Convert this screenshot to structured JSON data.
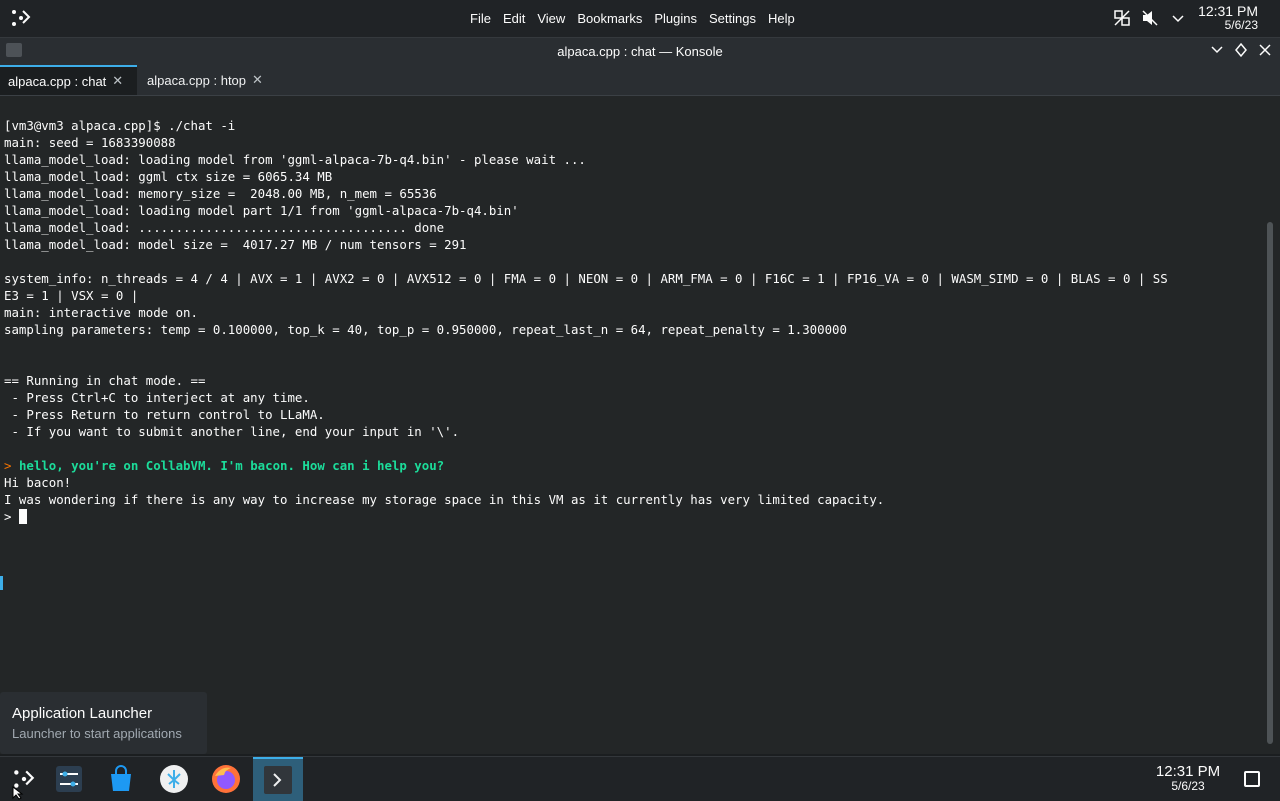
{
  "top_panel": {
    "menu": [
      "File",
      "Edit",
      "View",
      "Bookmarks",
      "Plugins",
      "Settings",
      "Help"
    ],
    "clock": {
      "time": "12:31 PM",
      "date": "5/6/23"
    }
  },
  "window": {
    "title": "alpaca.cpp : chat — Konsole"
  },
  "tabs": [
    {
      "label": "alpaca.cpp : chat",
      "active": true
    },
    {
      "label": "alpaca.cpp : htop",
      "active": false
    }
  ],
  "terminal": {
    "lines": [
      "[vm3@vm3 alpaca.cpp]$ ./chat -i",
      "main: seed = 1683390088",
      "llama_model_load: loading model from 'ggml-alpaca-7b-q4.bin' - please wait ...",
      "llama_model_load: ggml ctx size = 6065.34 MB",
      "llama_model_load: memory_size =  2048.00 MB, n_mem = 65536",
      "llama_model_load: loading model part 1/1 from 'ggml-alpaca-7b-q4.bin'",
      "llama_model_load: .................................... done",
      "llama_model_load: model size =  4017.27 MB / num tensors = 291",
      "",
      "system_info: n_threads = 4 / 4 | AVX = 1 | AVX2 = 0 | AVX512 = 0 | FMA = 0 | NEON = 0 | ARM_FMA = 0 | F16C = 1 | FP16_VA = 0 | WASM_SIMD = 0 | BLAS = 0 | SS",
      "E3 = 1 | VSX = 0 |",
      "main: interactive mode on.",
      "sampling parameters: temp = 0.100000, top_k = 40, top_p = 0.950000, repeat_last_n = 64, repeat_penalty = 1.300000",
      "",
      "",
      "== Running in chat mode. ==",
      " - Press Ctrl+C to interject at any time.",
      " - Press Return to return control to LLaMA.",
      " - If you want to submit another line, end your input in '\\'.",
      ""
    ],
    "prompt_symbol": ">",
    "user_input": "hello, you're on CollabVM. I'm bacon. How can i help you?",
    "response_lines": [
      "Hi bacon!",
      "I was wondering if there is any way to increase my storage space in this VM as it currently has very limited capacity."
    ],
    "current_prompt": ">"
  },
  "tooltip": {
    "title": "Application Launcher",
    "subtitle": "Launcher to start applications"
  },
  "taskbar": {
    "items": [
      "application-launcher-icon",
      "system-settings-icon",
      "discover-store-icon",
      "plasma-app-icon",
      "firefox-icon",
      "konsole-icon"
    ],
    "clock": {
      "time": "12:31 PM",
      "date": "5/6/23"
    }
  },
  "colors": {
    "accent": "#3daee9",
    "prompt": "#f67400",
    "user_input": "#1cdc9a"
  }
}
